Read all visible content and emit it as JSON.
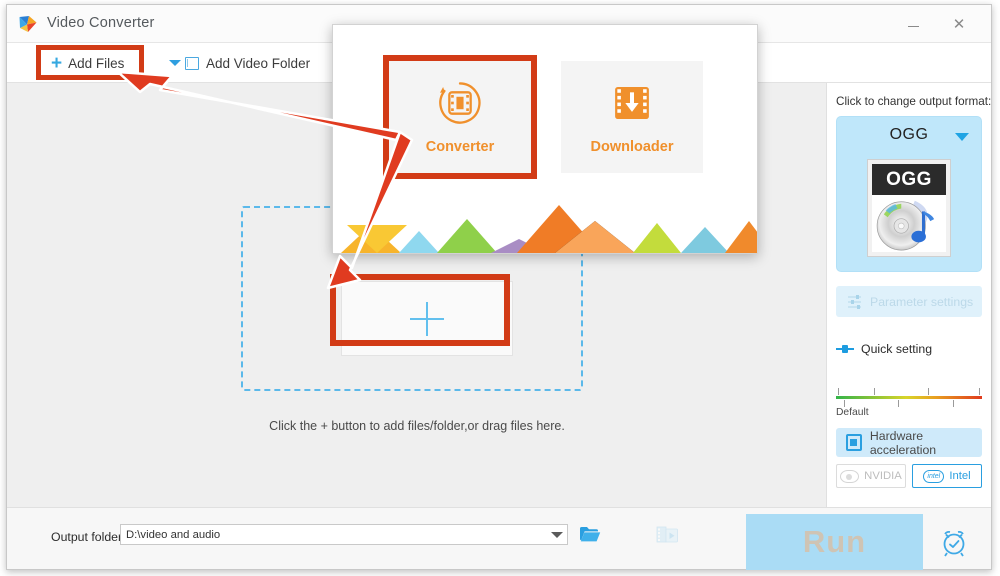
{
  "window": {
    "title": "Video Converter",
    "logo_icon": "app-logo-icon",
    "minimize_label": "–",
    "close_label": "✕"
  },
  "toolbar": {
    "add_files_label": "Add Files",
    "add_files_plus": "+",
    "dropdown_icon": "chevron-down-icon",
    "add_video_folder_label": "Add Video Folder",
    "folder_icon": "video-folder-icon"
  },
  "main": {
    "dropzone_plus_icon": "plus-icon",
    "hint": "Click the + button to add files/folder,or drag files here."
  },
  "right_panel": {
    "output_format_label": "Click to change output format:",
    "format_name": "OGG",
    "format_caret_icon": "chevron-down-icon",
    "format_thumb_text": "OGG",
    "format_thumb_icon": "audio-disc-icon",
    "parameter_settings_label": "Parameter settings",
    "parameter_settings_icon": "sliders-icon",
    "parameter_settings_disabled": true,
    "quick_setting_label": "Quick setting",
    "quick_setting_icon": "slider-handle-icon",
    "slider_default_label": "Default",
    "hardware_acceleration_label": "Hardware acceleration",
    "hardware_acceleration_icon": "cpu-chip-icon",
    "gpus": [
      {
        "label": "NVIDIA",
        "icon": "nvidia-eye-icon",
        "enabled": false
      },
      {
        "label": "Intel",
        "icon": "intel-badge-icon",
        "enabled": true
      }
    ]
  },
  "bottom_bar": {
    "output_folder_label": "Output folder:",
    "output_folder_value": "D:\\video and audio",
    "output_folder_placeholder": "D:\\video and audio",
    "output_folder_caret_icon": "chevron-down-icon",
    "browse_folder_icon": "open-folder-icon",
    "open_media_icon": "media-folder-icon",
    "run_label": "Run",
    "alarm_icon": "alarm-clock-icon"
  },
  "overlay": {
    "modes": [
      {
        "label": "Converter",
        "icon": "converter-film-circle-icon",
        "highlighted": true
      },
      {
        "label": "Downloader",
        "icon": "download-film-icon",
        "highlighted": false
      }
    ]
  },
  "colors": {
    "accent_blue": "#2a9fe0",
    "orange": "#f0902c",
    "annotation_red": "#d23b16",
    "panel_blue": "#bfe7fa",
    "run_blue": "#aadcf5",
    "window_bg": "#efefef"
  },
  "chart_data": null
}
